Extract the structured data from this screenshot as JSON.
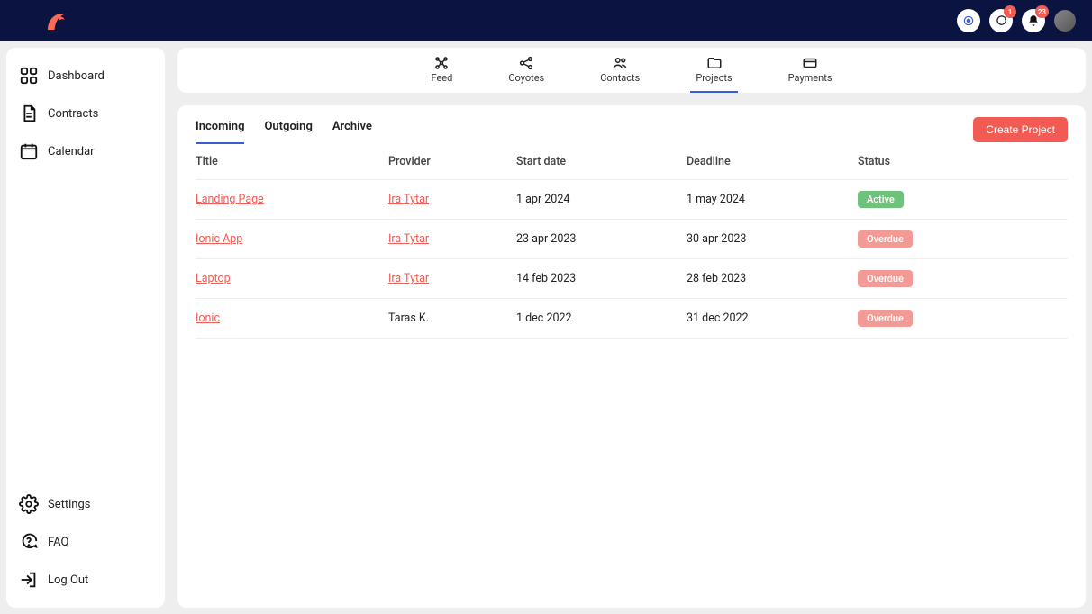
{
  "topbar": {
    "badges": {
      "messages": "1",
      "notifications": "23"
    }
  },
  "sidebar": {
    "primary": [
      {
        "label": "Dashboard"
      },
      {
        "label": "Contracts"
      },
      {
        "label": "Calendar"
      }
    ],
    "secondary": [
      {
        "label": "Settings"
      },
      {
        "label": "FAQ"
      },
      {
        "label": "Log Out"
      }
    ]
  },
  "nav": {
    "items": [
      {
        "label": "Feed"
      },
      {
        "label": "Coyotes"
      },
      {
        "label": "Contacts"
      },
      {
        "label": "Projects"
      },
      {
        "label": "Payments"
      }
    ]
  },
  "subtabs": {
    "items": [
      {
        "label": "Incoming"
      },
      {
        "label": "Outgoing"
      },
      {
        "label": "Archive"
      }
    ]
  },
  "buttons": {
    "create_project": "Create Project"
  },
  "table": {
    "headers": {
      "title": "Title",
      "provider": "Provider",
      "start": "Start date",
      "deadline": "Deadline",
      "status": "Status"
    },
    "rows": [
      {
        "title": "Landing Page",
        "provider": "Ira Tytar",
        "provider_link": true,
        "start": "1 apr 2024",
        "deadline": "1 may 2024",
        "status": "Active",
        "status_kind": "active"
      },
      {
        "title": "Ionic App",
        "provider": "Ira Tytar",
        "provider_link": true,
        "start": "23 apr 2023",
        "deadline": "30 apr 2023",
        "status": "Overdue",
        "status_kind": "overdue"
      },
      {
        "title": "Laptop",
        "provider": "Ira Tytar",
        "provider_link": true,
        "start": "14 feb 2023",
        "deadline": "28 feb 2023",
        "status": "Overdue",
        "status_kind": "overdue"
      },
      {
        "title": "Ionic",
        "provider": "Taras K.",
        "provider_link": false,
        "start": "1 dec 2022",
        "deadline": "31 dec 2022",
        "status": "Overdue",
        "status_kind": "overdue"
      }
    ]
  }
}
